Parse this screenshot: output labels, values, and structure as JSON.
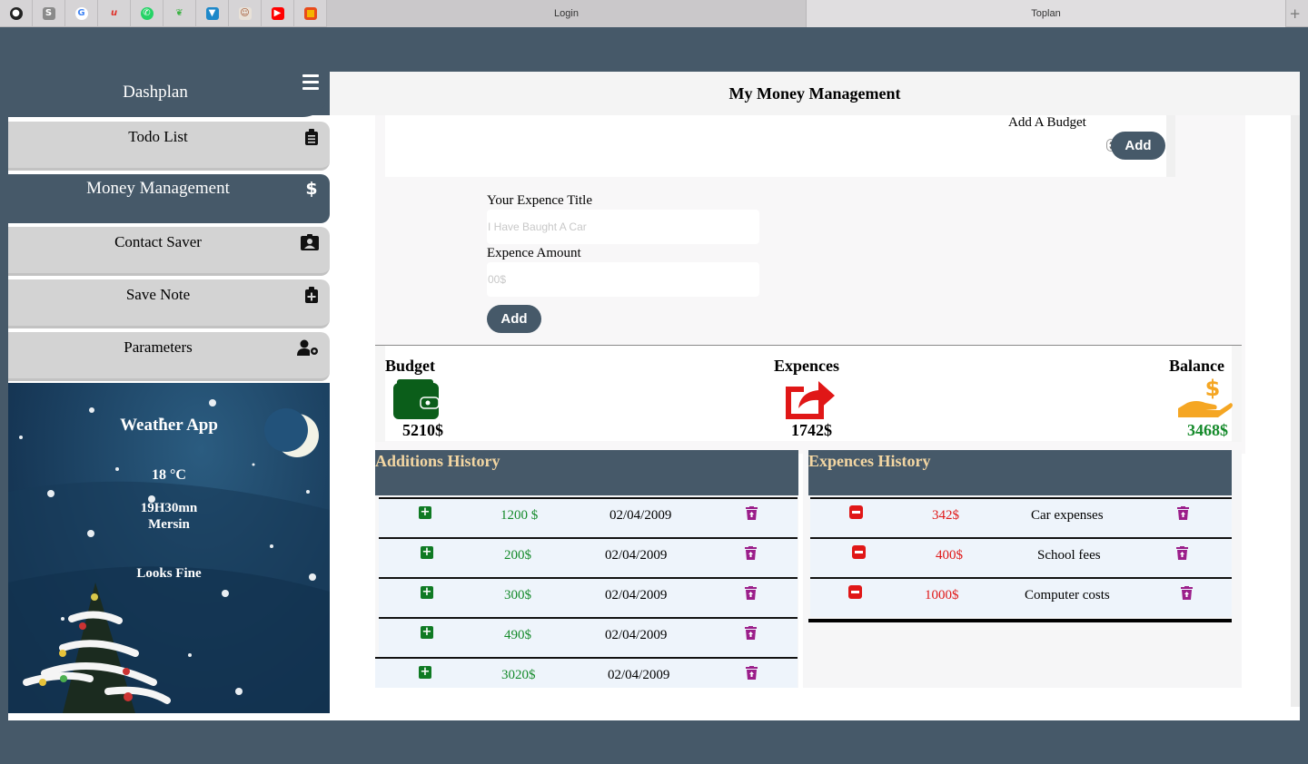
{
  "browser": {
    "favicons": [
      "github-icon",
      "s-icon",
      "google-icon",
      "u-icon",
      "whatsapp-icon",
      "leaf-icon",
      "vcard-icon",
      "profile-icon",
      "youtube-icon",
      "slides-icon"
    ],
    "tabs": [
      {
        "label": "Login"
      },
      {
        "label": "Toplan"
      }
    ],
    "new_tab": "+"
  },
  "sidebar": {
    "brand": "Dashplan",
    "items": [
      {
        "label": "Todo List",
        "icon": "clipboard-list-icon",
        "active": false
      },
      {
        "label": "Money Management",
        "icon": "dollar-icon",
        "active": true
      },
      {
        "label": "Contact Saver",
        "icon": "contact-card-icon",
        "active": false
      },
      {
        "label": "Save Note",
        "icon": "clipboard-plus-icon",
        "active": false
      },
      {
        "label": "Parameters",
        "icon": "user-gear-icon",
        "active": false
      }
    ]
  },
  "weather": {
    "title": "Weather App",
    "temperature": "18 °C",
    "time": "19H30mn",
    "city": "Mersin",
    "status": "Looks Fine"
  },
  "header": {
    "title": "My Money Management"
  },
  "budget_form": {
    "label": "Add A Budget",
    "add_label": "Add"
  },
  "expense_form": {
    "title_label": "Your Expence Title",
    "title_placeholder": "I Have Baught A Car",
    "amount_label": "Expence Amount",
    "amount_placeholder": "00$",
    "add_label": "Add"
  },
  "stats": {
    "budget": {
      "label": "Budget",
      "value": "5210$"
    },
    "expenses": {
      "label": "Expences",
      "value": "1742$"
    },
    "balance": {
      "label": "Balance",
      "value": "3468$"
    }
  },
  "additions_history": {
    "title": "Additions History",
    "rows": [
      {
        "amount": "1200 $",
        "date": "02/04/2009"
      },
      {
        "amount": "200$",
        "date": "02/04/2009"
      },
      {
        "amount": "300$",
        "date": "02/04/2009"
      },
      {
        "amount": "490$",
        "date": "02/04/2009"
      },
      {
        "amount": "3020$",
        "date": "02/04/2009"
      }
    ]
  },
  "expenses_history": {
    "title": "Expences History",
    "rows": [
      {
        "amount": "342$",
        "title": "Car expenses"
      },
      {
        "amount": "400$",
        "title": "School fees"
      },
      {
        "amount": "1000$",
        "title": "Computer costs"
      }
    ]
  },
  "colors": {
    "primary": "#465969",
    "income": "#148a2a",
    "expense": "#e01717",
    "wallet": "#0b5e1a",
    "balance_icon": "#f5a623",
    "trash": "#9b1e8a",
    "history_title": "#f3d6a2"
  }
}
